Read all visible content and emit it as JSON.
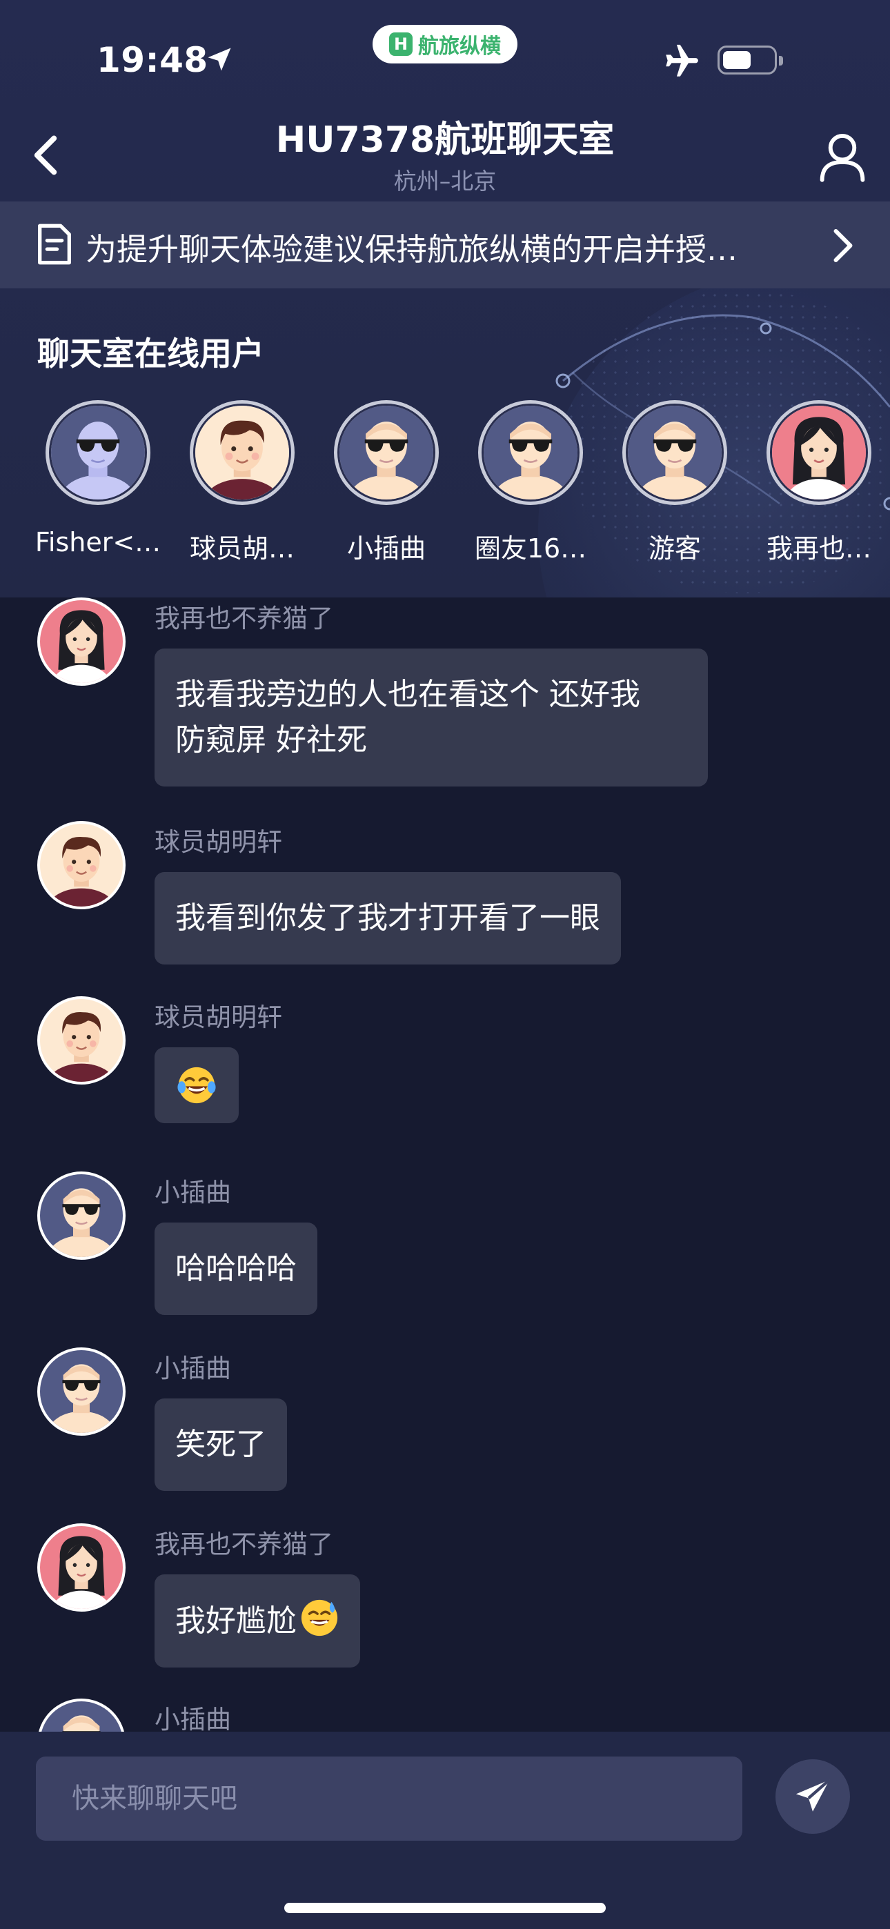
{
  "status_bar": {
    "time": "19:48",
    "app_pill": "航旅纵横"
  },
  "nav": {
    "title": "HU7378航班聊天室",
    "subtitle": "杭州–北京"
  },
  "notice": {
    "text": "为提升聊天体验建议保持航旅纵横的开启并授…"
  },
  "online": {
    "title": "聊天室在线用户",
    "users": [
      {
        "name": "Fisher<…",
        "avatar": "sunglasses-blue-avatar"
      },
      {
        "name": "球员胡…",
        "avatar": "brown-hair-boy-avatar"
      },
      {
        "name": "小插曲",
        "avatar": "sunglasses-avatar"
      },
      {
        "name": "圈友16…",
        "avatar": "sunglasses-avatar"
      },
      {
        "name": "游客",
        "avatar": "sunglasses-avatar"
      },
      {
        "name": "我再也…",
        "avatar": "long-hair-girl-avatar"
      }
    ]
  },
  "messages": [
    {
      "sender": "我再也不养猫了",
      "text_lines": [
        "我看我旁边的人也在看这个 还好我",
        "防窥屏 好社死"
      ]
    },
    {
      "sender": "球员胡明轩",
      "text": "我看到你发了我才打开看了一眼"
    },
    {
      "sender": "球员胡明轩",
      "emoji": "laughing-tears-emoji"
    },
    {
      "sender": "小插曲",
      "text": "哈哈哈哈"
    },
    {
      "sender": "小插曲",
      "text": "笑死了"
    },
    {
      "sender": "我再也不养猫了",
      "text": "我好尴尬",
      "emoji": "sweat-smile-emoji"
    },
    {
      "sender": "小插曲"
    }
  ],
  "composer": {
    "placeholder": "快来聊聊天吧"
  },
  "colors": {
    "header_bg": "#252b50",
    "chat_bg": "#161a30",
    "bubble_bg": "#363a4f",
    "notice_bg": "#363c5d",
    "input_bg": "#3c4164",
    "brand_green": "#3bb36e"
  }
}
